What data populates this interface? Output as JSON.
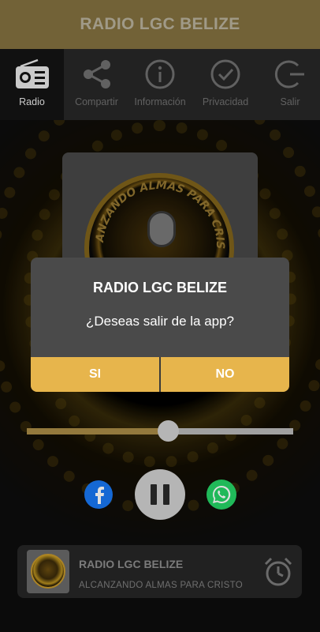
{
  "app": {
    "title": "RADIO LGC BELIZE"
  },
  "tabs": [
    {
      "label": "Radio",
      "icon": "radio-icon",
      "active": true
    },
    {
      "label": "Compartir",
      "icon": "share-icon",
      "active": false
    },
    {
      "label": "Información",
      "icon": "info-icon",
      "active": false
    },
    {
      "label": "Privacidad",
      "icon": "check-circle-icon",
      "active": false
    },
    {
      "label": "Salir",
      "icon": "exit-icon",
      "active": false
    }
  ],
  "player": {
    "volume_fraction": 0.53,
    "station": "RADIO LGC BELIZE",
    "slogan": "ALCANZANDO ALMAS PARA CRISTO",
    "logo_text": "ALCANZANDO ALMAS PARA CRISTO"
  },
  "social": {
    "facebook": "facebook-icon",
    "whatsapp": "whatsapp-icon"
  },
  "dialog": {
    "title": "RADIO LGC BELIZE",
    "message": "¿Deseas salir de la app?",
    "yes_label": "SI",
    "no_label": "NO"
  },
  "colors": {
    "accent": "#e7b54c",
    "appbar": "#82703f",
    "facebook": "#1877f2",
    "whatsapp": "#25d366"
  }
}
